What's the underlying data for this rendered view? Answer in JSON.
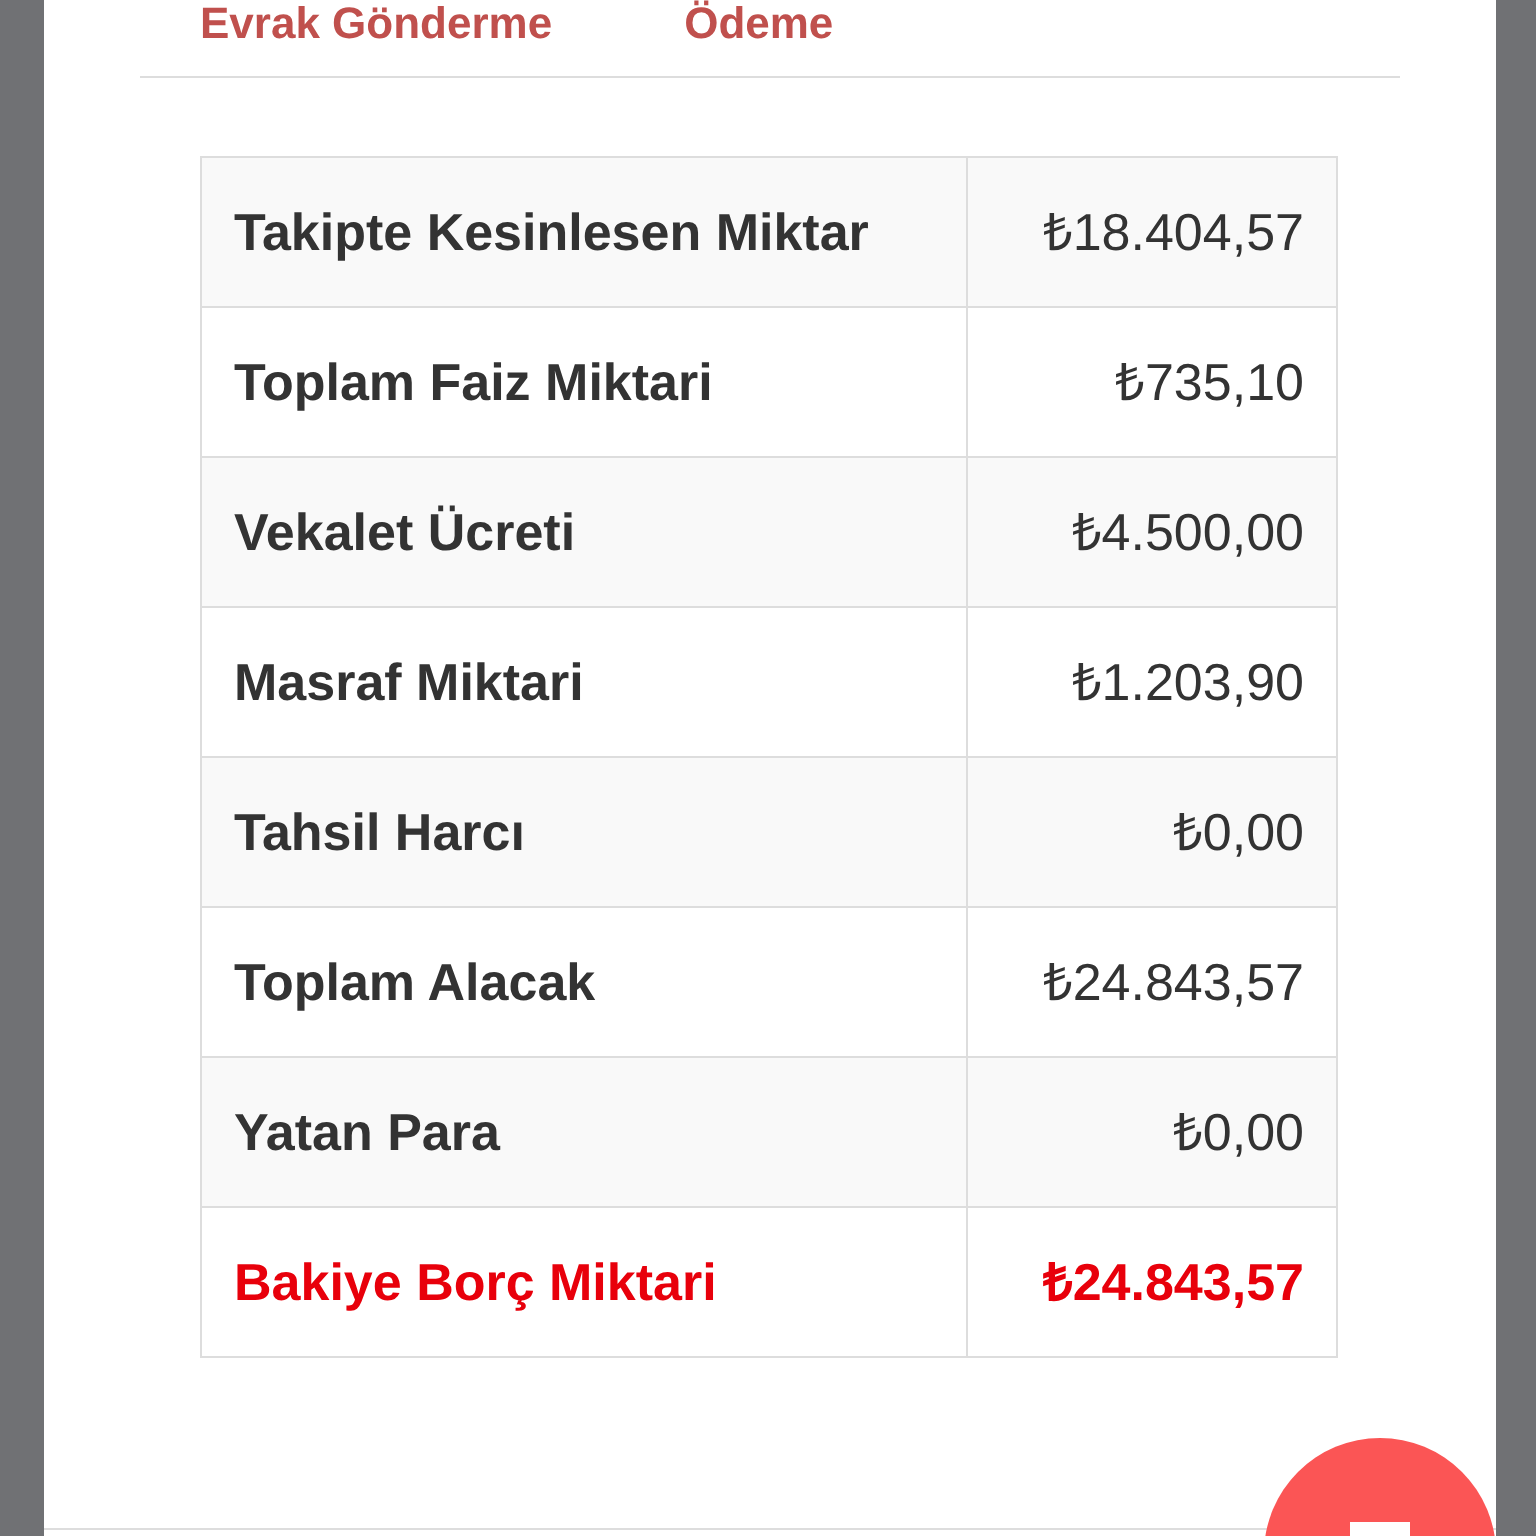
{
  "tabs": [
    {
      "label": "Evrak Gönderme"
    },
    {
      "label": "Ödeme"
    }
  ],
  "table": {
    "rows": [
      {
        "kind": "item",
        "label": "Takipte Kesinlesen Miktar",
        "value": "₺18.404,57"
      },
      {
        "kind": "item",
        "label": "Toplam Faiz Miktari",
        "value": "₺735,10"
      },
      {
        "kind": "item",
        "label": "Vekalet Ücreti",
        "value": "₺4.500,00"
      },
      {
        "kind": "item",
        "label": "Masraf Miktari",
        "value": "₺1.203,90"
      },
      {
        "kind": "item",
        "label": "Tahsil Harcı",
        "value": "₺0,00"
      },
      {
        "kind": "item",
        "label": "Toplam Alacak",
        "value": "₺24.843,57"
      },
      {
        "kind": "item",
        "label": "Yatan Para",
        "value": "₺0,00"
      },
      {
        "kind": "total",
        "label": "Bakiye Borç Miktari",
        "value": "₺24.843,57"
      }
    ]
  }
}
